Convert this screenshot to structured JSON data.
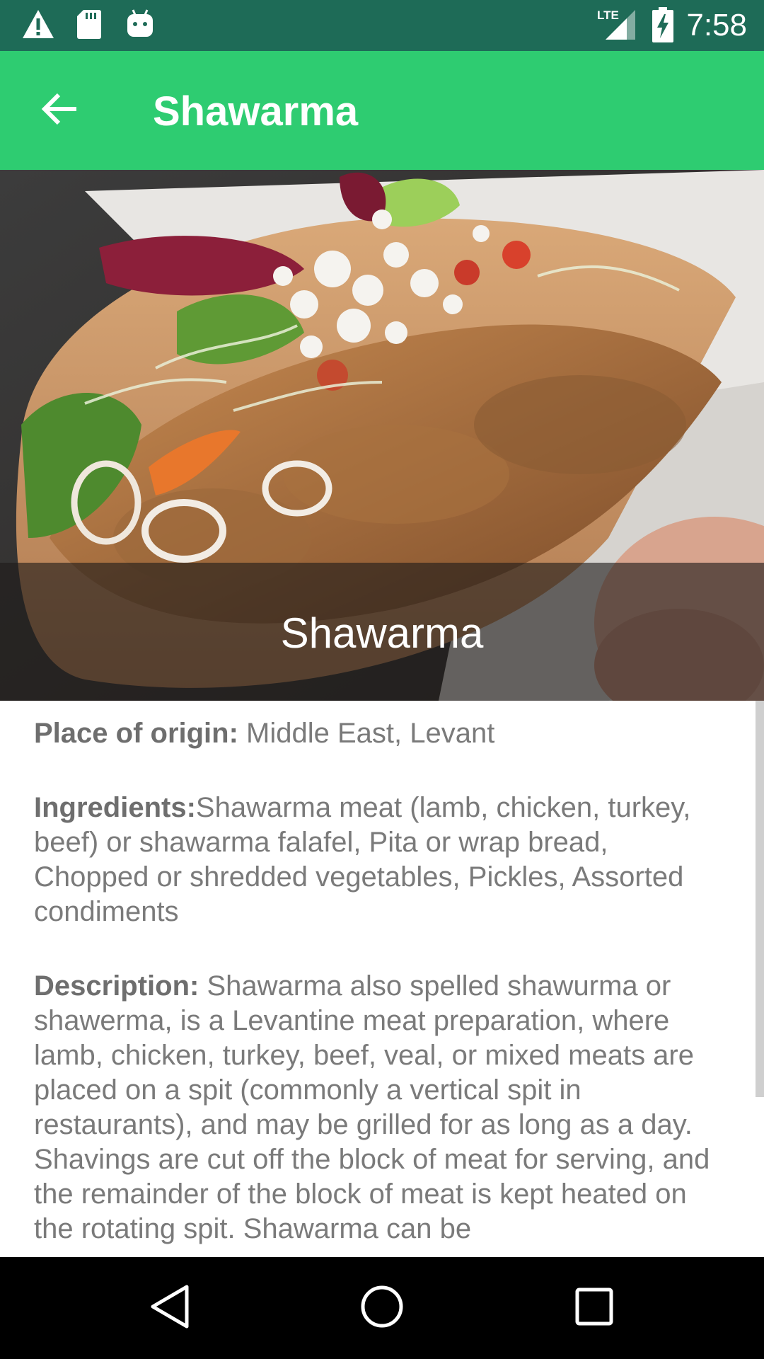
{
  "status_bar": {
    "time": "7:58",
    "network": "LTE",
    "icons": [
      "warning-icon",
      "sd-card-icon",
      "android-icon",
      "lte-signal-icon",
      "battery-charging-icon"
    ]
  },
  "toolbar": {
    "title": "Shawarma",
    "back_icon": "arrow-back-icon",
    "color": "#2ecc71"
  },
  "hero": {
    "caption": "Shawarma"
  },
  "details": {
    "origin_label": "Place of origin:",
    "origin_value": " Middle East, Levant",
    "ingredients_label": "Ingredients:",
    "ingredients_value": "Shawarma meat (lamb, chicken, turkey, beef) or shawarma falafel, Pita or wrap bread, Chopped or shredded vegetables, Pickles, Assorted condiments",
    "description_label": "Description:",
    "description_value": " Shawarma also spelled shawurma or shawerma, is a Levantine meat preparation, where lamb, chicken, turkey, beef, veal, or mixed meats are placed on a spit (commonly a vertical spit in restaurants), and may be grilled for as long as a day. Shavings are cut off the block of meat for serving, and the remainder of the block of meat is kept heated on the rotating spit. Shawarma can be"
  },
  "nav_bar": {
    "icons": [
      "back-triangle-icon",
      "home-circle-icon",
      "recents-square-icon"
    ]
  },
  "colors": {
    "status_bar": "#1e6b57",
    "accent": "#2ecc71",
    "body_text": "#7a7a7a"
  }
}
